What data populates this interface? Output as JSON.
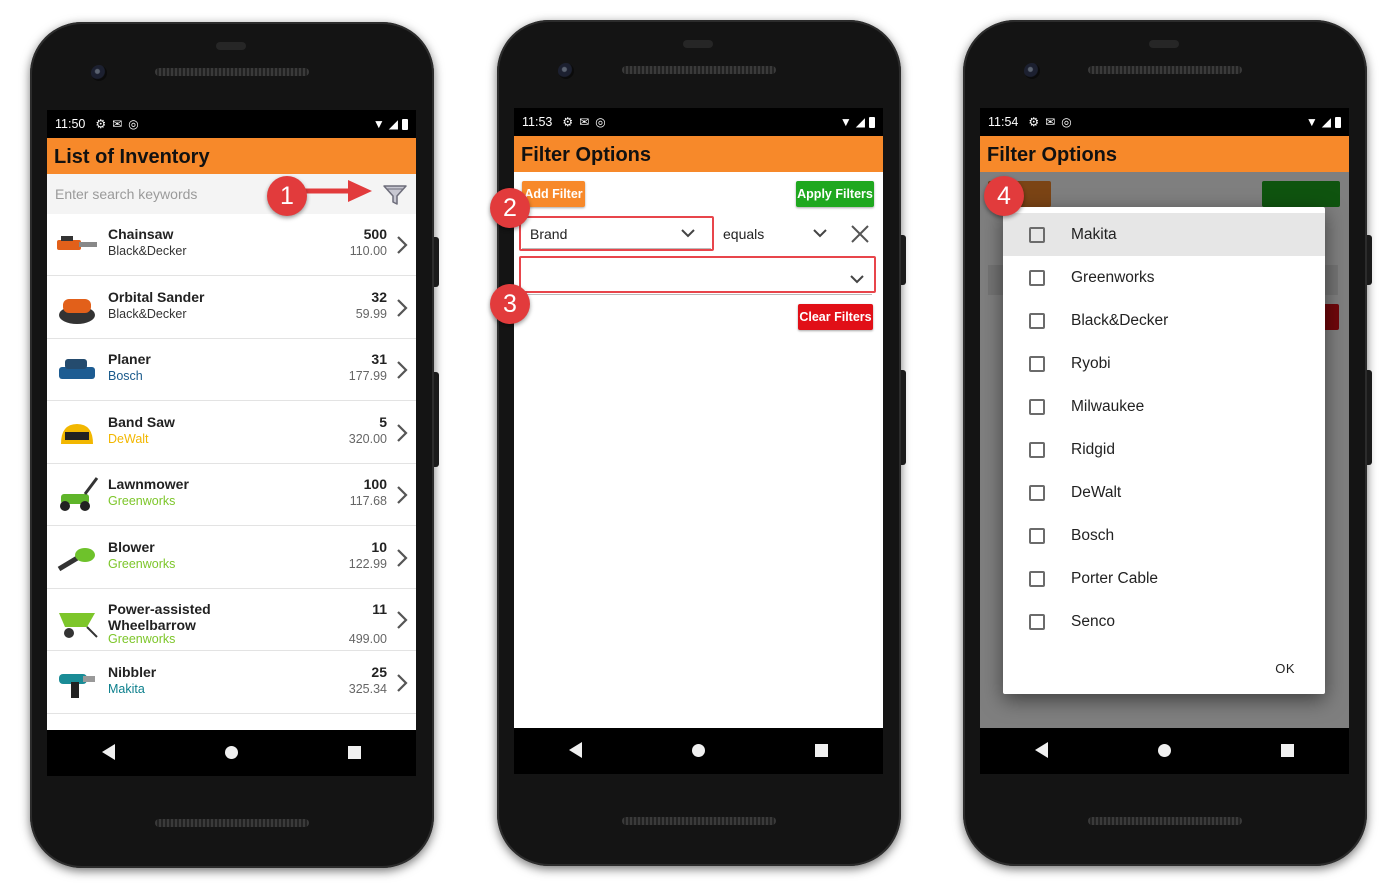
{
  "colors": {
    "accent": "#f7892a",
    "apply": "#1fa81f",
    "clear": "#e10f17",
    "callout": "#e23b3c"
  },
  "screen1": {
    "status": {
      "time": "11:50"
    },
    "title": "List of Inventory",
    "search": {
      "placeholder": "Enter search keywords",
      "icon": "filter-funnel-icon"
    },
    "items": [
      {
        "name": "Chainsaw",
        "brand": "Black&Decker",
        "brand_color": "#333333",
        "qty": "500",
        "price": "110.00",
        "icon": "chainsaw-icon"
      },
      {
        "name": "Orbital Sander",
        "brand": "Black&Decker",
        "brand_color": "#333333",
        "qty": "32",
        "price": "59.99",
        "icon": "sander-icon"
      },
      {
        "name": "Planer",
        "brand": "Bosch",
        "brand_color": "#1a5a8c",
        "qty": "31",
        "price": "177.99",
        "icon": "planer-icon"
      },
      {
        "name": "Band Saw",
        "brand": "DeWalt",
        "brand_color": "#f2b700",
        "qty": "5",
        "price": "320.00",
        "icon": "bandsaw-icon"
      },
      {
        "name": "Lawnmower",
        "brand": "Greenworks",
        "brand_color": "#7dc62a",
        "qty": "100",
        "price": "117.68",
        "icon": "lawnmower-icon"
      },
      {
        "name": "Blower",
        "brand": "Greenworks",
        "brand_color": "#7dc62a",
        "qty": "10",
        "price": "122.99",
        "icon": "blower-icon"
      },
      {
        "name": "Power-assisted Wheelbarrow",
        "brand": "Greenworks",
        "brand_color": "#7dc62a",
        "qty": "11",
        "price": "499.00",
        "icon": "wheelbarrow-icon"
      },
      {
        "name": "Nibbler",
        "brand": "Makita",
        "brand_color": "#0c7f8c",
        "qty": "25",
        "price": "325.34",
        "icon": "nibbler-icon"
      }
    ]
  },
  "screen2": {
    "status": {
      "time": "11:53"
    },
    "title": "Filter Options",
    "add_filter": "Add Filter",
    "apply_filters": "Apply Filters",
    "field_select": "Brand",
    "operator_select": "equals",
    "value_select": "",
    "clear_filters": "Clear Filters"
  },
  "screen3": {
    "status": {
      "time": "11:54"
    },
    "title": "Filter Options",
    "options": [
      "Makita",
      "Greenworks",
      "Black&Decker",
      "Ryobi",
      "Milwaukee",
      "Ridgid",
      "DeWalt",
      "Bosch",
      "Porter Cable",
      "Senco"
    ],
    "ok": "OK"
  },
  "callouts": [
    "1",
    "2",
    "3",
    "4"
  ]
}
